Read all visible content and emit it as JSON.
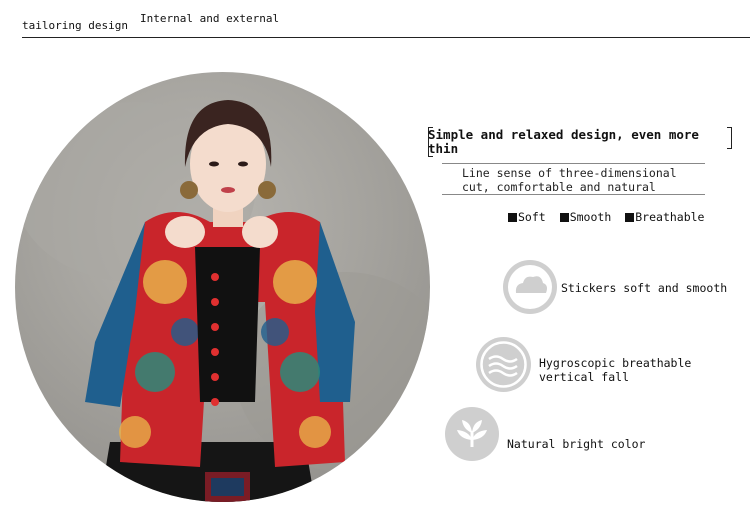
{
  "header": {
    "left_tab": "tailoring design",
    "right_tab": "Internal and external"
  },
  "headline": "Simple and relaxed design, even more thin",
  "subtext": "Line sense of three-dimensional cut, comfortable and natural",
  "badges": [
    "Soft",
    "Smooth",
    "Breathable"
  ],
  "features": [
    {
      "icon": "cloud-icon",
      "text": "Stickers soft and smooth"
    },
    {
      "icon": "waves-icon",
      "text": "Hygroscopic breathable vertical fall"
    },
    {
      "icon": "leaf-icon",
      "text": "Natural bright color"
    }
  ],
  "colors": {
    "icon_bg": "#cfcfcf",
    "backdrop": "#a5a39e",
    "jacket_red": "#c9252b",
    "jacket_blue": "#1f5f8e"
  }
}
